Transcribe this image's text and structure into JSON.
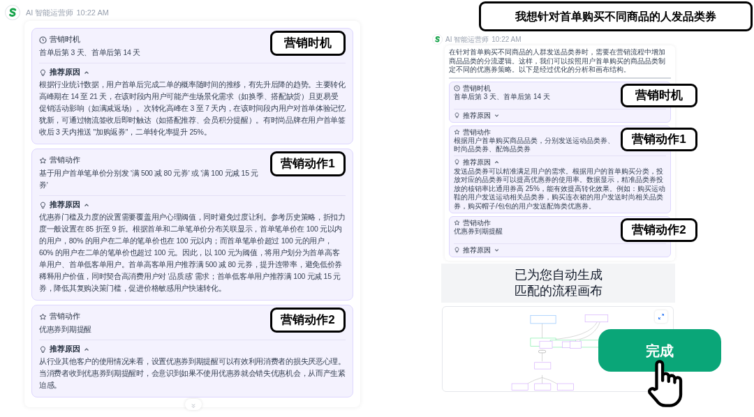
{
  "left_panel": {
    "sender": "AI 智能运营师",
    "time": "10:22 AM",
    "cards": [
      {
        "kind": "timing",
        "title": "营销时机",
        "value": "首单后第 3 天、首单后第 14 天",
        "annotation": "营销时机",
        "reason_label": "推荐原因",
        "expanded": true,
        "reason": "根据行业统计数据，用户首单后完成二单的概率随时间的推移，有先升后降的趋势。主要转化高峰期在 14 至 21 天，在该时段内用户可能产生场景化需求（如换季、搭配缺货）且更易受促销活动影响（如满减返场）。次转化高峰在 3 至 7 天内，在该时间段内用户对首单体验记忆犹新，可通过物流签收后即时触达（如搭配推荐、会员积分提醒）。有时尚品牌在用户首单签收后 3 天内推送 \"加购返券\"，二单转化率提升 25%。"
      },
      {
        "kind": "action",
        "title": "营销动作",
        "value": "基于用户首单笔单价分别发 '满 500 减 80 元券' 或 '满 100 元减 15 元券'",
        "annotation": "营销动作1",
        "reason_label": "推荐原因",
        "expanded": true,
        "reason": "优惠券门槛及力度的设置需要覆盖用户心理阈值，同时避免过度让利。参考历史策略，折扣力度一般设置在 85 折至 9 折。根据首单和二单笔单价分布关联显示，首单笔单价在 100 元以内的用户，80% 的用户在二单的笔单价也在 100 元以内；而首单笔单价超过 100 元的用户，60% 的用户在二单的笔单价也超过 100 元。因此，以 100 元为阈值，将用户划分为首单高客单用户、首单低客单用户。首单高客单用户推荐满 500 减 80 元券，提升连带率，避免低价券稀释用户价值，同时契合高消费用户对 '品质感' 需求；首单低客单用户推荐满 100 元减 15 元券，降低其复购决策门槛，促进价格敏感用户快速转化。"
      },
      {
        "kind": "action",
        "title": "营销动作",
        "value": "优惠券到期提醒",
        "annotation": "营销动作2",
        "reason_label": "推荐原因",
        "expanded": true,
        "reason": "从行业其他客户的使用情况来看，设置优惠券到期提醒可以有效利用消费者的损失厌恶心理。当消费者收到优惠券到期提醒时，会意识到如果不使用优惠券就会错失优惠机会，从而产生紧迫感。"
      }
    ]
  },
  "right_panel": {
    "prompt_banner": "我想针对首单购买不同商品的人发品类券",
    "sender": "AI 智能运营师",
    "time": "10:22 AM",
    "intro": "在针对首单购买不同商品的人群发送品类券时，需要在营销流程中增加商品品类的分流逻辑。这样，我们可以按照用户首单购买的商品品类制定不同的优惠券策略。以下是经过优化的分析和画布结构。",
    "cards": [
      {
        "kind": "timing",
        "title": "营销时机",
        "value": "首单后第 3 天、首单后第 14 天",
        "annotation": "营销时机",
        "reason_label": "推荐原因",
        "expanded": false
      },
      {
        "kind": "action",
        "title": "营销动作",
        "value": "根据用户首单购买商品品类，分别发送运动品类券、时尚品类券、配饰品类券",
        "annotation": "营销动作1",
        "reason_label": "推荐原因",
        "expanded": true,
        "reason": "发送品类券可以精准满足用户的需求。根据用户的首单购买分类，投放对应的品类券可以提高优惠券的使用率。数据显示，精准品类券投放的核销率比通用券高 25%，能有效提高转化效果。例如：购买运动鞋的用户发送运动相关品类券，购买连衣裙的用户发送时尚相关品类券，购买帽子/包包的用户发送配饰类优惠券。"
      },
      {
        "kind": "action",
        "title": "营销动作",
        "value": "优惠券到期提醒",
        "annotation": "营销动作2",
        "reason_label": "推荐原因",
        "expanded": false
      }
    ],
    "caption_lines": [
      "已为您自动生成",
      "匹配的流程画布"
    ],
    "done_button": "完成"
  }
}
